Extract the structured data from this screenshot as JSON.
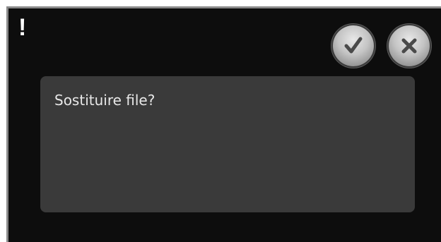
{
  "dialog": {
    "alert_symbol": "!",
    "message": "Sostituire file?",
    "confirm_icon": "check-icon",
    "cancel_icon": "close-icon"
  }
}
